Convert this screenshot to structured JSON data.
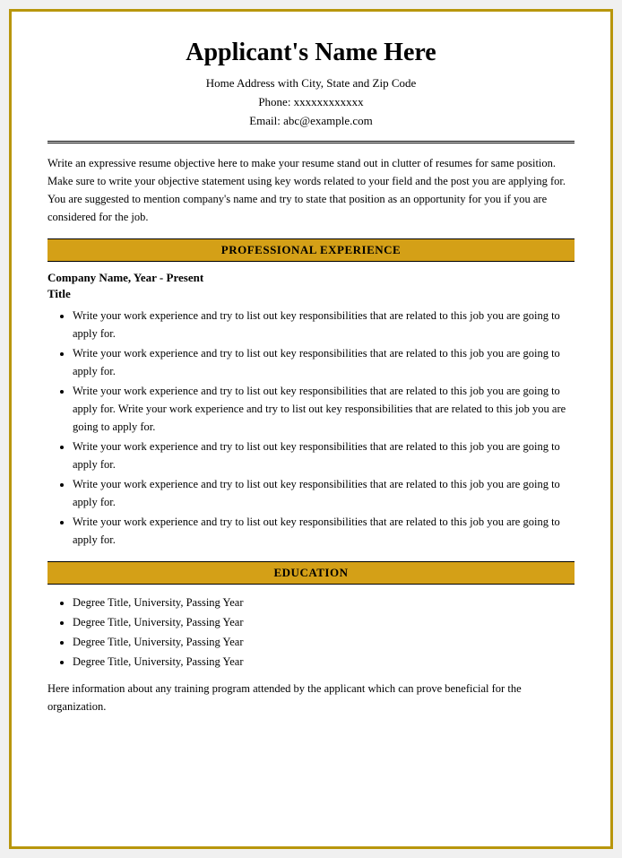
{
  "header": {
    "name": "Applicant's Name Here",
    "address": "Home Address with City, State and Zip Code",
    "phone": "Phone: xxxxxxxxxxxx",
    "email": "Email: abc@example.com"
  },
  "objective": {
    "text": "Write an expressive resume objective here to make your resume stand out in clutter of resumes for same position. Make sure to write your objective statement using key words related to your field and the post you are applying for. You are suggested to mention company's name and try to state that position as an opportunity for you if you are considered for the job."
  },
  "sections": {
    "professional_experience_label": "PROFESSIONAL EXPERIENCE",
    "education_label": "EDUCATION"
  },
  "experience": {
    "company_line": "Company Name, Year - Present",
    "title_line": "Title",
    "bullets": [
      "Write your work experience and try to list out key responsibilities that are related to this job you are going to apply for.",
      "Write your work experience and try to list out key responsibilities that are related to this job you are going to apply for.",
      "Write your work experience and try to list out key responsibilities that are related to this job you are going to apply for. Write your work experience and try to list out key responsibilities that are related to this job you are going to apply for.",
      "Write your work experience and try to list out key responsibilities that are related to this job you are going to apply for.",
      "Write your work experience and try to list out key responsibilities that are related to this job you are going to apply for.",
      "Write your work experience and try to list out key responsibilities that are related to this job you are going to apply for."
    ]
  },
  "education": {
    "degrees": [
      "Degree Title, University, Passing Year",
      "Degree Title, University, Passing Year",
      "Degree Title, University, Passing Year",
      "Degree Title, University, Passing Year"
    ],
    "training_note": "Here information about any training program attended by the applicant which can prove beneficial for the organization."
  }
}
